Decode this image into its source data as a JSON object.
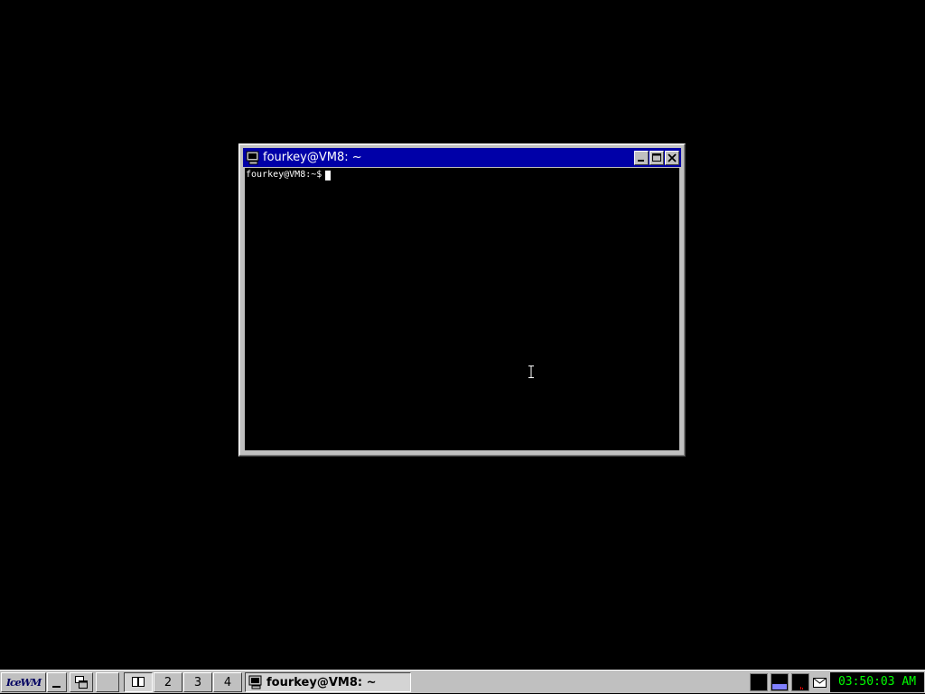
{
  "window": {
    "title": "fourkey@VM8: ~",
    "icon": "terminal-icon",
    "buttons": [
      "minimize",
      "maximize",
      "close"
    ]
  },
  "terminal": {
    "prompt": "fourkey@VM8:~$"
  },
  "taskbar": {
    "start_logo": "IceWM",
    "workspaces": [
      "1",
      "2",
      "3",
      "4"
    ],
    "active_workspace": "1",
    "task_label": "fourkey@VM8: ~",
    "clock": "03:50:03 AM"
  },
  "colors": {
    "titlebar": "#0000a8",
    "clock_text": "#00ff00",
    "desktop": "#000000",
    "chrome": "#c0c0c0"
  }
}
